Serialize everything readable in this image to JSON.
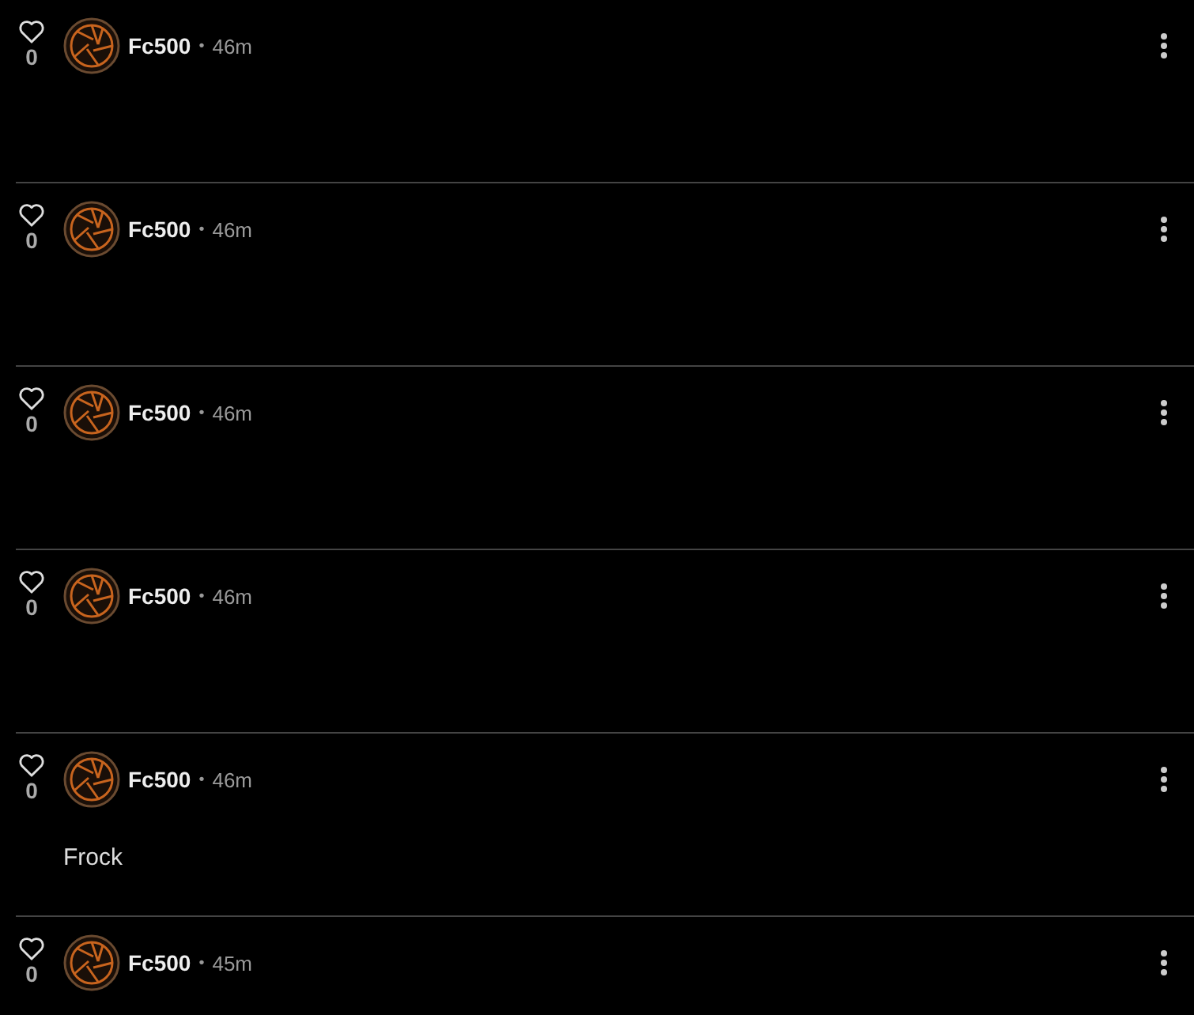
{
  "posts": [
    {
      "likes": "0",
      "author": "Fc500",
      "separator": "•",
      "time": "46m"
    },
    {
      "likes": "0",
      "author": "Fc500",
      "separator": "•",
      "time": "46m"
    },
    {
      "likes": "0",
      "author": "Fc500",
      "separator": "•",
      "time": "46m"
    },
    {
      "likes": "0",
      "author": "Fc500",
      "separator": "•",
      "time": "46m"
    },
    {
      "likes": "0",
      "author": "Fc500",
      "separator": "•",
      "time": "46m",
      "text": "Frock"
    },
    {
      "likes": "0",
      "author": "Fc500",
      "separator": "•",
      "time": "45m"
    }
  ]
}
